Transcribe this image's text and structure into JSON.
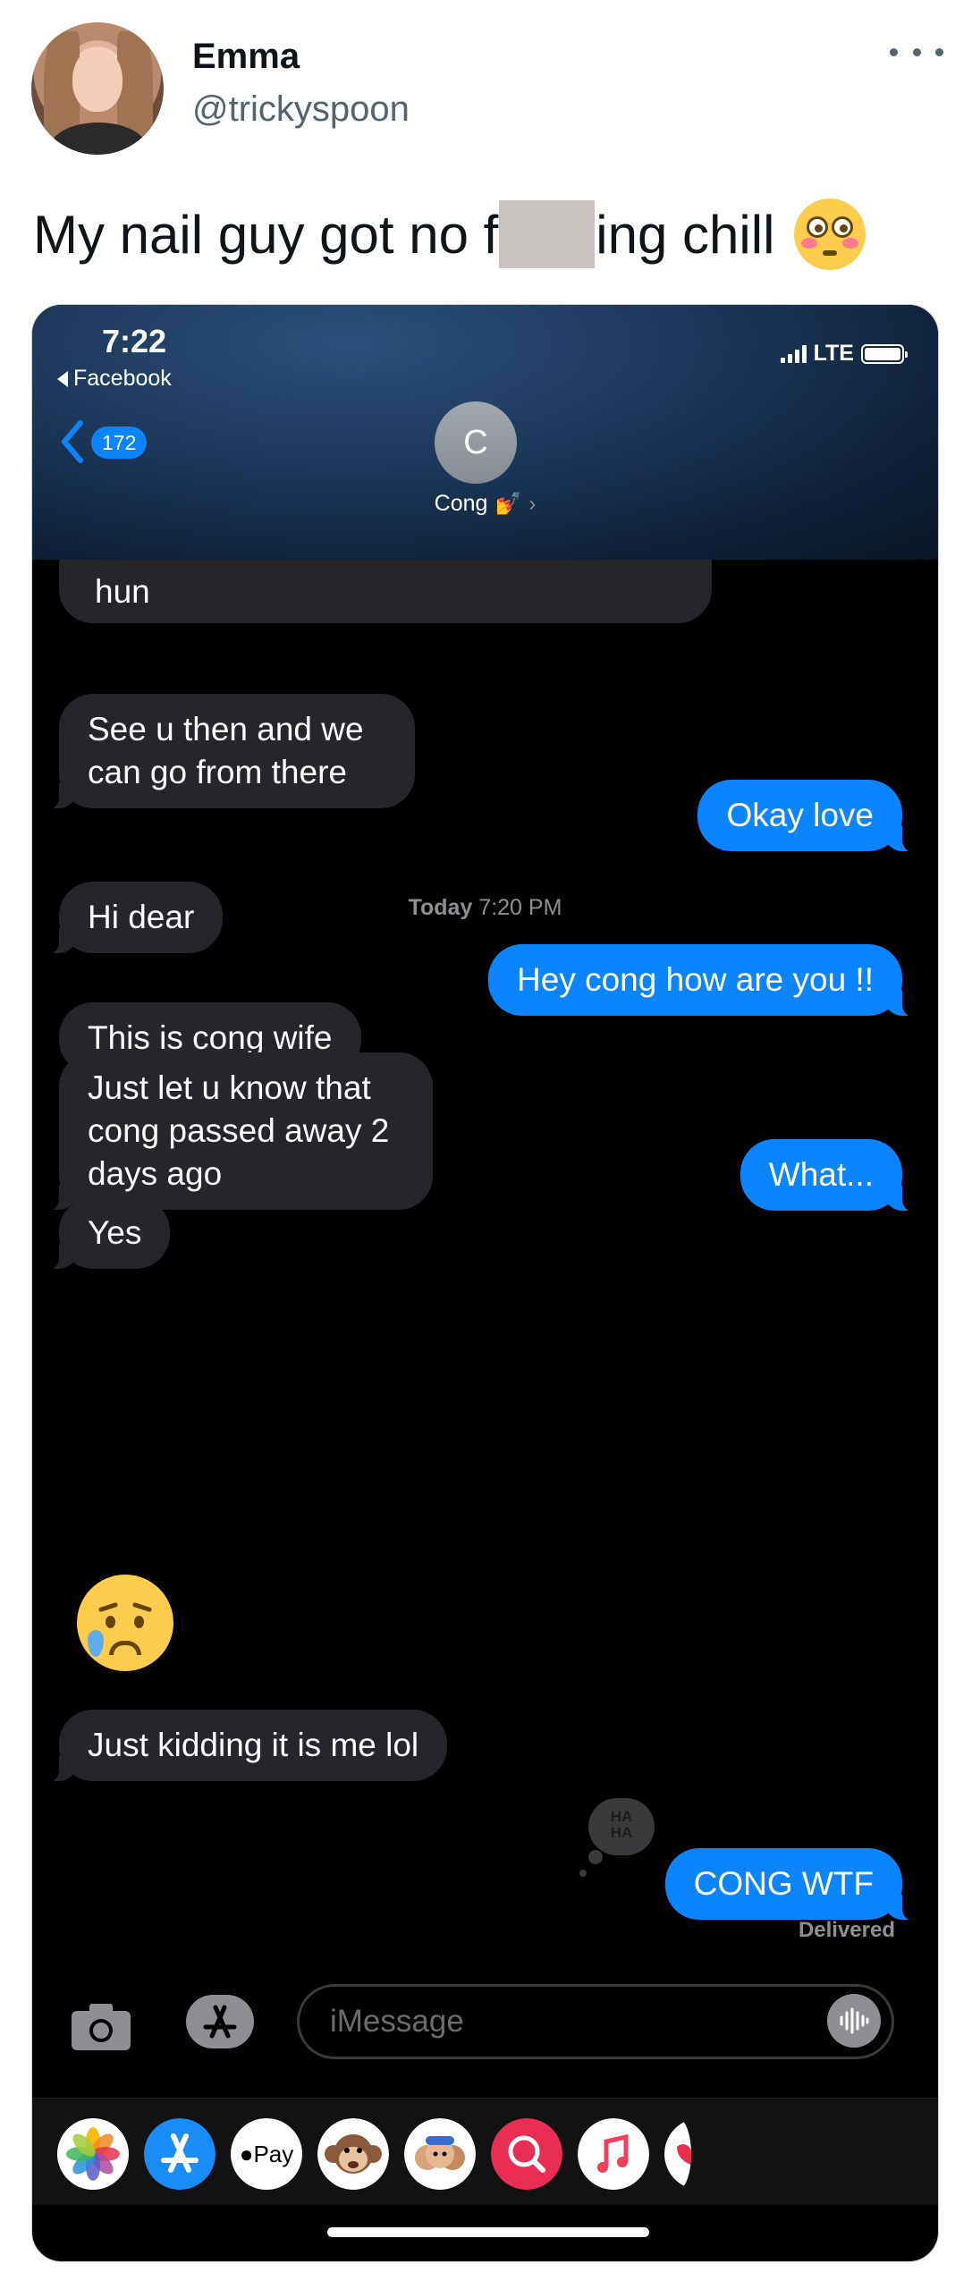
{
  "tweet": {
    "display_name": "Emma",
    "handle": "@trickyspoon",
    "text_start": "My nail guy got no f",
    "text_end": "ing chill"
  },
  "phone": {
    "status_bar": {
      "time": "7:22",
      "back_app": "Facebook",
      "network": "LTE"
    },
    "nav": {
      "unread_count": "172",
      "contact_initial": "C",
      "contact_name": "Cong",
      "contact_emoji": "💅"
    },
    "messages": {
      "cut_off_text": "hun",
      "m1": "See u then and we can go from there",
      "m2": "Okay love",
      "timestamp_day": "Today",
      "timestamp_time": "7:20 PM",
      "m3": "Hi dear",
      "m4": "Hey cong how are you !!",
      "m5": "This is cong wife",
      "m6": "Just let u know that cong passed away 2 days ago",
      "m7": "What...",
      "m8": "Yes",
      "m9": "Just kidding it is me lol",
      "tapback_line1": "HA",
      "tapback_line2": "HA",
      "m10": "CONG WTF",
      "delivered": "Delivered"
    },
    "input": {
      "placeholder": "iMessage"
    },
    "apps": {
      "apple_pay_label": "Pay",
      "icons": [
        "photos-icon",
        "app-store-icon",
        "apple-pay-icon",
        "monkey-memoji-icon",
        "memoji-icon",
        "search-images-icon",
        "music-icon",
        "heart-app-icon"
      ]
    },
    "colors": {
      "outgoing": "#0a84ff",
      "incoming": "#26252a",
      "background": "#000000"
    }
  }
}
